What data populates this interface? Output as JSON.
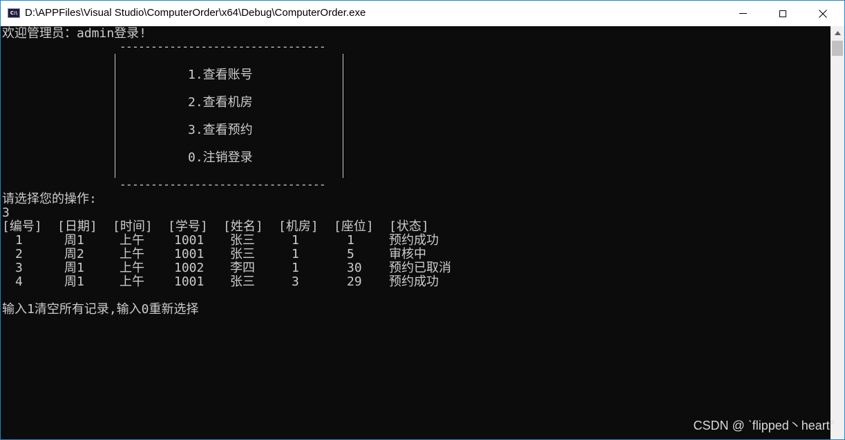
{
  "window": {
    "title": "D:\\APPFiles\\Visual Studio\\ComputerOrder\\x64\\Debug\\ComputerOrder.exe",
    "icon_label": "C:\\"
  },
  "console": {
    "welcome": "欢迎管理员：admin登录!",
    "menu_border": "---------------------------------",
    "menu": [
      "1.查看账号",
      "2.查看机房",
      "3.查看预约",
      "0.注销登录"
    ],
    "prompt": "请选择您的操作:",
    "input": "3",
    "table": {
      "headers": [
        "[编号]",
        "[日期]",
        "[时间]",
        "[学号]",
        "[姓名]",
        "[机房]",
        "[座位]",
        "[状态]"
      ],
      "rows": [
        [
          "1",
          "周1",
          "上午",
          "1001",
          "张三",
          "1",
          "1",
          "预约成功"
        ],
        [
          "2",
          "周2",
          "上午",
          "1001",
          "张三",
          "1",
          "5",
          "审核中"
        ],
        [
          "3",
          "周1",
          "上午",
          "1002",
          "李四",
          "1",
          "30",
          "预约已取消"
        ],
        [
          "4",
          "周1",
          "上午",
          "1001",
          "张三",
          "3",
          "29",
          "预约成功"
        ]
      ]
    },
    "footer_prompt": "输入1清空所有记录,输入0重新选择"
  },
  "watermark": "CSDN @ ˋflipped丶heart°",
  "colors": {
    "console_bg": "#0c0c0c",
    "console_text": "#cccccc",
    "titlebar_bg": "#ffffff",
    "window_border": "#1d86c9"
  },
  "icons": [
    "console-app-icon",
    "minimize-icon",
    "maximize-icon",
    "close-icon",
    "scroll-up-arrow-icon"
  ]
}
